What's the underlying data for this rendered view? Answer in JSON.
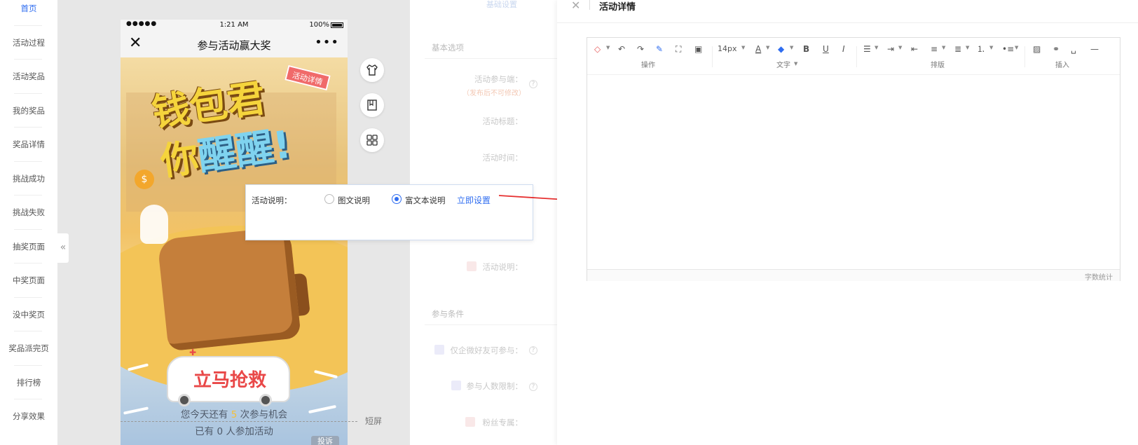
{
  "nav": {
    "items": [
      "首页",
      "活动过程",
      "活动奖品",
      "我的奖品",
      "奖品详情",
      "挑战成功",
      "挑战失败",
      "抽奖页面",
      "中奖页面",
      "没中奖页",
      "奖品派完页",
      "排行榜",
      "分享效果"
    ],
    "active_index": 0,
    "collapse_glyph": "«"
  },
  "phone": {
    "status": {
      "dots": "●●●●●",
      "time": "1:21 AM",
      "battery": "100%"
    },
    "title": "参与活动赢大奖",
    "close_glyph": "✕",
    "more_glyph": "•••",
    "poster": {
      "headline_line1": "钱包君",
      "headline_line2_a": "你",
      "headline_line2_b": "醒醒!",
      "tag": "活动详情",
      "coin": "$",
      "ambulance_text": "立马抢救",
      "ambulance_cross": "✚",
      "info_prefix": "您今天还有",
      "info_count": "5",
      "info_suffix": "次参与机会",
      "info2_prefix": "已有",
      "info2_count": "0",
      "info2_suffix": "人参加活动"
    },
    "corner_button": "投诉"
  },
  "screen_split_label": "短屏",
  "tools": [
    "shirt-icon",
    "book-icon",
    "grid-icon"
  ],
  "settings": {
    "top_label": "基础设置",
    "section_basic": "基本选项",
    "fields": {
      "entry": "活动参与端：",
      "entry_hint": "（发布后不可修改）",
      "title": "活动标题：",
      "time": "活动时间：",
      "desc": "活动说明："
    },
    "section_conditions": "参与条件",
    "cond_fields": {
      "wecom": "仅企微好友可参与：",
      "limit": "参与人数限制：",
      "fans": "粉丝专属："
    }
  },
  "popup": {
    "label": "活动说明：",
    "option1": "图文说明",
    "option2": "富文本说明",
    "selected": 2,
    "link": "立即设置"
  },
  "drawer": {
    "close_glyph": "✕",
    "title": "活动详情",
    "toolbar": {
      "groups": [
        "操作",
        "文字",
        "排版",
        "插入"
      ],
      "font_size": "14px",
      "bold": "B",
      "underline": "U",
      "italic": "I",
      "font_color": "A"
    },
    "wordcount": "字数统计"
  },
  "colors": {
    "accent": "#2f6df0",
    "arrow": "#e63030"
  }
}
